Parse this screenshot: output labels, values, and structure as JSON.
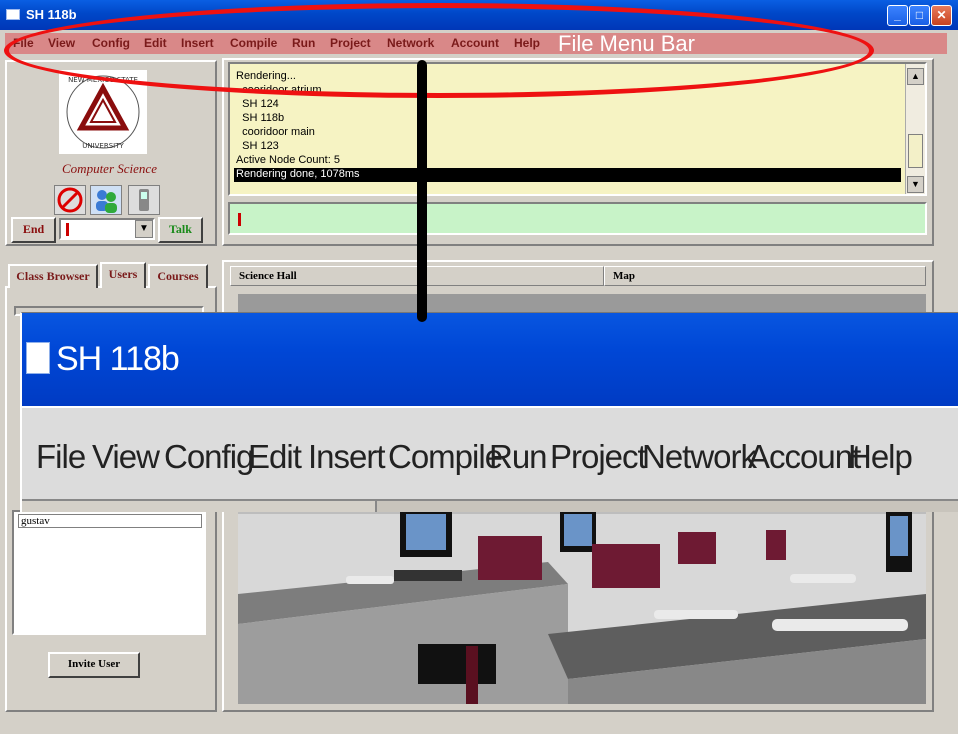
{
  "window": {
    "title": "SH 118b"
  },
  "window_controls": {
    "minimize": "_",
    "maximize": "□",
    "close": "✕"
  },
  "menu": {
    "items": [
      "File",
      "View",
      "Config",
      "Edit",
      "Insert",
      "Compile",
      "Run",
      "Project",
      "Network",
      "Account",
      "Help"
    ],
    "annotation": "File Menu Bar"
  },
  "sidebar": {
    "department": "Computer Science",
    "end_label": "End",
    "talk_label": "Talk",
    "tabs": [
      "Class Browser",
      "Users",
      "Courses"
    ],
    "users": [
      "gustav"
    ],
    "invite_label": "Invite User"
  },
  "console": {
    "lines": [
      {
        "text": "Rendering..."
      },
      {
        "text": "  cooridoor atrium"
      },
      {
        "text": "  SH 124"
      },
      {
        "text": "  SH 118b"
      },
      {
        "text": "  cooridoor main"
      },
      {
        "text": "  SH 123"
      },
      {
        "text": "Active Node Count: 5"
      },
      {
        "text": "Rendering done, 1078ms",
        "highlighted": true
      }
    ]
  },
  "view": {
    "tabs": [
      "Science Hall",
      "Map"
    ]
  },
  "zoom_inset": {
    "title": "SH 118b",
    "menu_items": [
      "File",
      "View",
      "Config",
      "Edit",
      "Insert",
      "Compile",
      "Run",
      "Project",
      "Network",
      "Account",
      "Help"
    ]
  },
  "colors": {
    "menubar": "#d98888",
    "console_bg": "#f6f3c3",
    "input_bg": "#c8f3c8",
    "annotation": "#ee1111",
    "titlebar": "#0047c8",
    "brand": "#8a0d0d"
  }
}
